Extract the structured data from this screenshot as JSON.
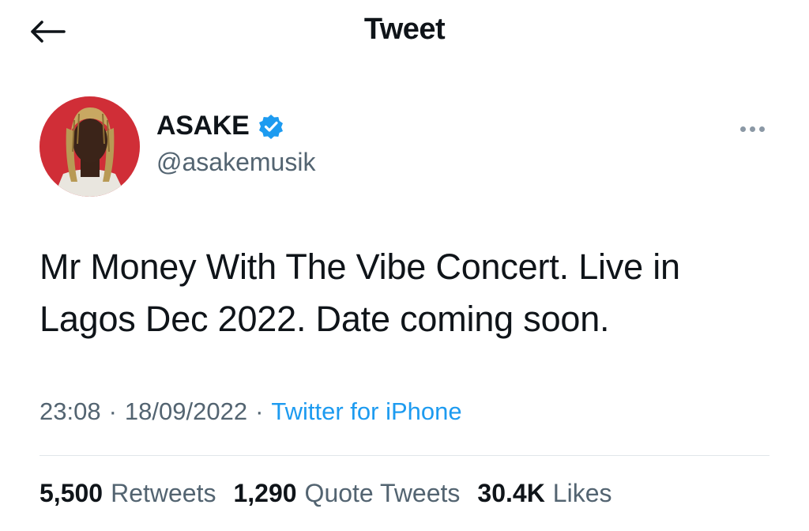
{
  "header": {
    "title": "Tweet",
    "back_icon": "arrow-left-icon"
  },
  "author": {
    "display_name": "ASAKE",
    "handle": "@asakemusik",
    "verified": true,
    "verified_color": "#1d9bf0"
  },
  "tweet": {
    "text": "Mr Money With The Vibe Concert. Live in Lagos Dec 2022. Date coming soon.",
    "time": "23:08",
    "separator": "·",
    "date": "18/09/2022",
    "source": "Twitter for iPhone"
  },
  "stats": {
    "retweets_count": "5,500",
    "retweets_label": "Retweets",
    "quotes_count": "1,290",
    "quotes_label": "Quote Tweets",
    "likes_count": "30.4K",
    "likes_label": "Likes"
  },
  "colors": {
    "link": "#1d9bf0",
    "secondary_text": "#536471",
    "primary_text": "#0f1419",
    "avatar_background": "#d8303a"
  }
}
